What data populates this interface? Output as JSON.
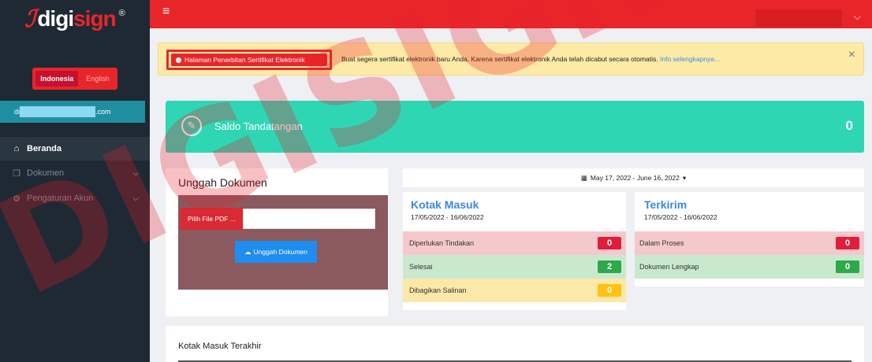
{
  "brand": {
    "text_a": "digi",
    "text_b": "sign",
    "reg": "®"
  },
  "language": {
    "options": [
      "Indonesia",
      "English"
    ],
    "selected": "Indonesia"
  },
  "account": {
    "email_prefix": "di",
    "email_suffix": ".com"
  },
  "sidebar": {
    "items": [
      {
        "label": "Beranda",
        "icon": "home-icon",
        "active": true
      },
      {
        "label": "Dokumen",
        "icon": "document-icon"
      },
      {
        "label": "Pengaturan Akun",
        "icon": "gear-icon"
      }
    ]
  },
  "topbar": {
    "menu_icon": "hamburger-icon"
  },
  "alert": {
    "button_label": "Halaman Penerbitan Sertifikat Elektronik",
    "message": "Buat segera sertifikat elektronik baru Anda. Karena sertifikat elektronik Anda telah dicabut secara otomatis.",
    "link": "Info selengkapnya...",
    "close": "×"
  },
  "saldo": {
    "label": "Saldo Tandatangan",
    "value": "0"
  },
  "upload": {
    "title": "Unggah Dokumen",
    "pick_label": "Pilih File PDF ...",
    "upload_label": "Unggah Dokumen"
  },
  "date_range": {
    "label": "May 17, 2022 - June 16, 2022"
  },
  "inbox": {
    "title": "Kotak Masuk",
    "range": "17/05/2022 - 16/06/2022",
    "rows": [
      {
        "label": "Diperlukan Tindakan",
        "count": "0"
      },
      {
        "label": "Selesai",
        "count": "2"
      },
      {
        "label": "Dibagikan Salinan",
        "count": "0"
      }
    ]
  },
  "sent": {
    "title": "Terkirim",
    "range": "17/05/2022 - 16/06/2022",
    "rows": [
      {
        "label": "Dalam Proses",
        "count": "0"
      },
      {
        "label": "Dokumen Lengkap",
        "count": "0"
      }
    ]
  },
  "recent": {
    "title": "Kotak Masuk Terakhir"
  },
  "watermark": {
    "text": "DIGISIGN.ID"
  },
  "colors": {
    "primary_red": "#e8262a",
    "teal": "#2fd6b4",
    "sidebar": "#1f2933",
    "link_blue": "#3a88e6"
  }
}
